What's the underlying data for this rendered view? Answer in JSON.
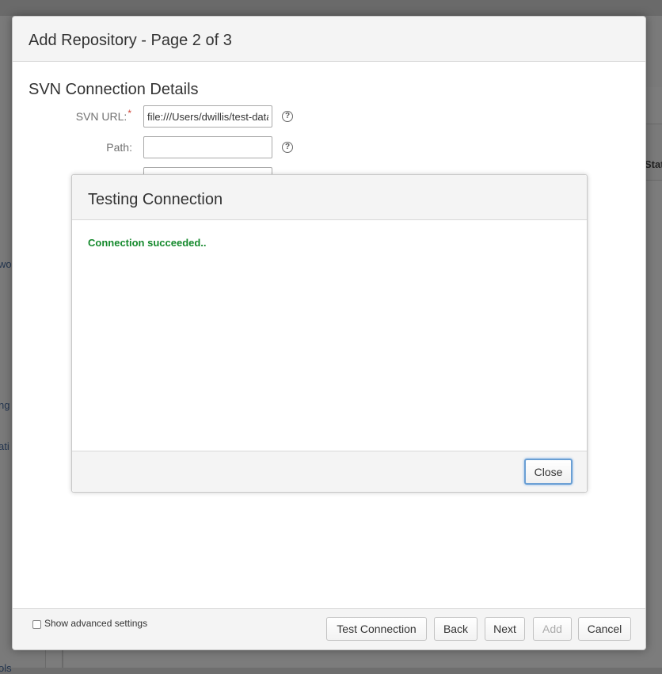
{
  "background": {
    "left_fragments": [
      "wor",
      "ng",
      "ati",
      "ols"
    ],
    "right_header": "Stat"
  },
  "dialog": {
    "title": "Add Repository - Page 2 of 3",
    "section_title": "SVN Connection Details",
    "fields": {
      "svn_url": {
        "label": "SVN URL:",
        "required_mark": "*",
        "value": "file:///Users/dwillis/test-data"
      },
      "path": {
        "label": "Path:",
        "value": ""
      }
    },
    "help_icon_glyph": "?",
    "footer": {
      "show_advanced_label": "Show advanced settings",
      "buttons": {
        "test_connection": "Test Connection",
        "back": "Back",
        "next": "Next",
        "add": "Add",
        "cancel": "Cancel"
      }
    }
  },
  "testing_dialog": {
    "title": "Testing Connection",
    "message": "Connection succeeded..",
    "close_label": "Close",
    "message_color": "#14892c"
  }
}
